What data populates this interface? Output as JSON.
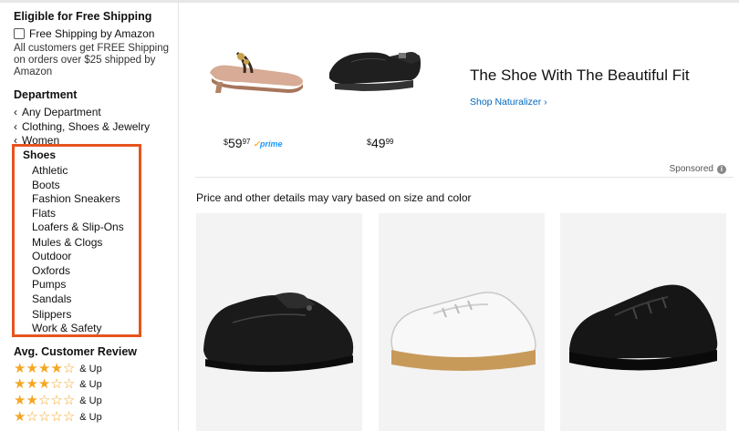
{
  "sidebar": {
    "free_shipping_heading": "Eligible for Free Shipping",
    "free_shipping_option": "Free Shipping by Amazon",
    "free_shipping_note": "All customers get FREE Shipping on orders over $25 shipped by Amazon",
    "department_heading": "Department",
    "breadcrumbs": [
      "Any Department",
      "Clothing, Shoes & Jewelry",
      "Women"
    ],
    "current_category": "Shoes",
    "categories": [
      "Athletic",
      "Boots",
      "Fashion Sneakers",
      "Flats",
      "Loafers & Slip-Ons",
      "Mules & Clogs",
      "Outdoor",
      "Oxfords",
      "Pumps",
      "Sandals",
      "Slippers",
      "Work & Safety"
    ],
    "review_heading": "Avg. Customer Review",
    "review_rows": [
      {
        "stars": 4,
        "label": "& Up"
      },
      {
        "stars": 3,
        "label": "& Up"
      },
      {
        "stars": 2,
        "label": "& Up"
      },
      {
        "stars": 1,
        "label": "& Up"
      }
    ]
  },
  "sponsored_ad": {
    "products": [
      {
        "price_symbol": "$",
        "price_whole": "59",
        "price_fraction": "97",
        "prime": "prime"
      },
      {
        "price_symbol": "$",
        "price_whole": "49",
        "price_fraction": "99"
      }
    ],
    "headline": "The Shoe With The Beautiful Fit",
    "link": "Shop Naturalizer ›",
    "sponsored_label": "Sponsored",
    "info_icon": "i"
  },
  "results": {
    "price_note": "Price and other details may vary based on size and color"
  },
  "colors": {
    "highlight": "#e8541f",
    "link": "#0066c0",
    "star": "#f5a623",
    "prime": "#1a98ff"
  }
}
